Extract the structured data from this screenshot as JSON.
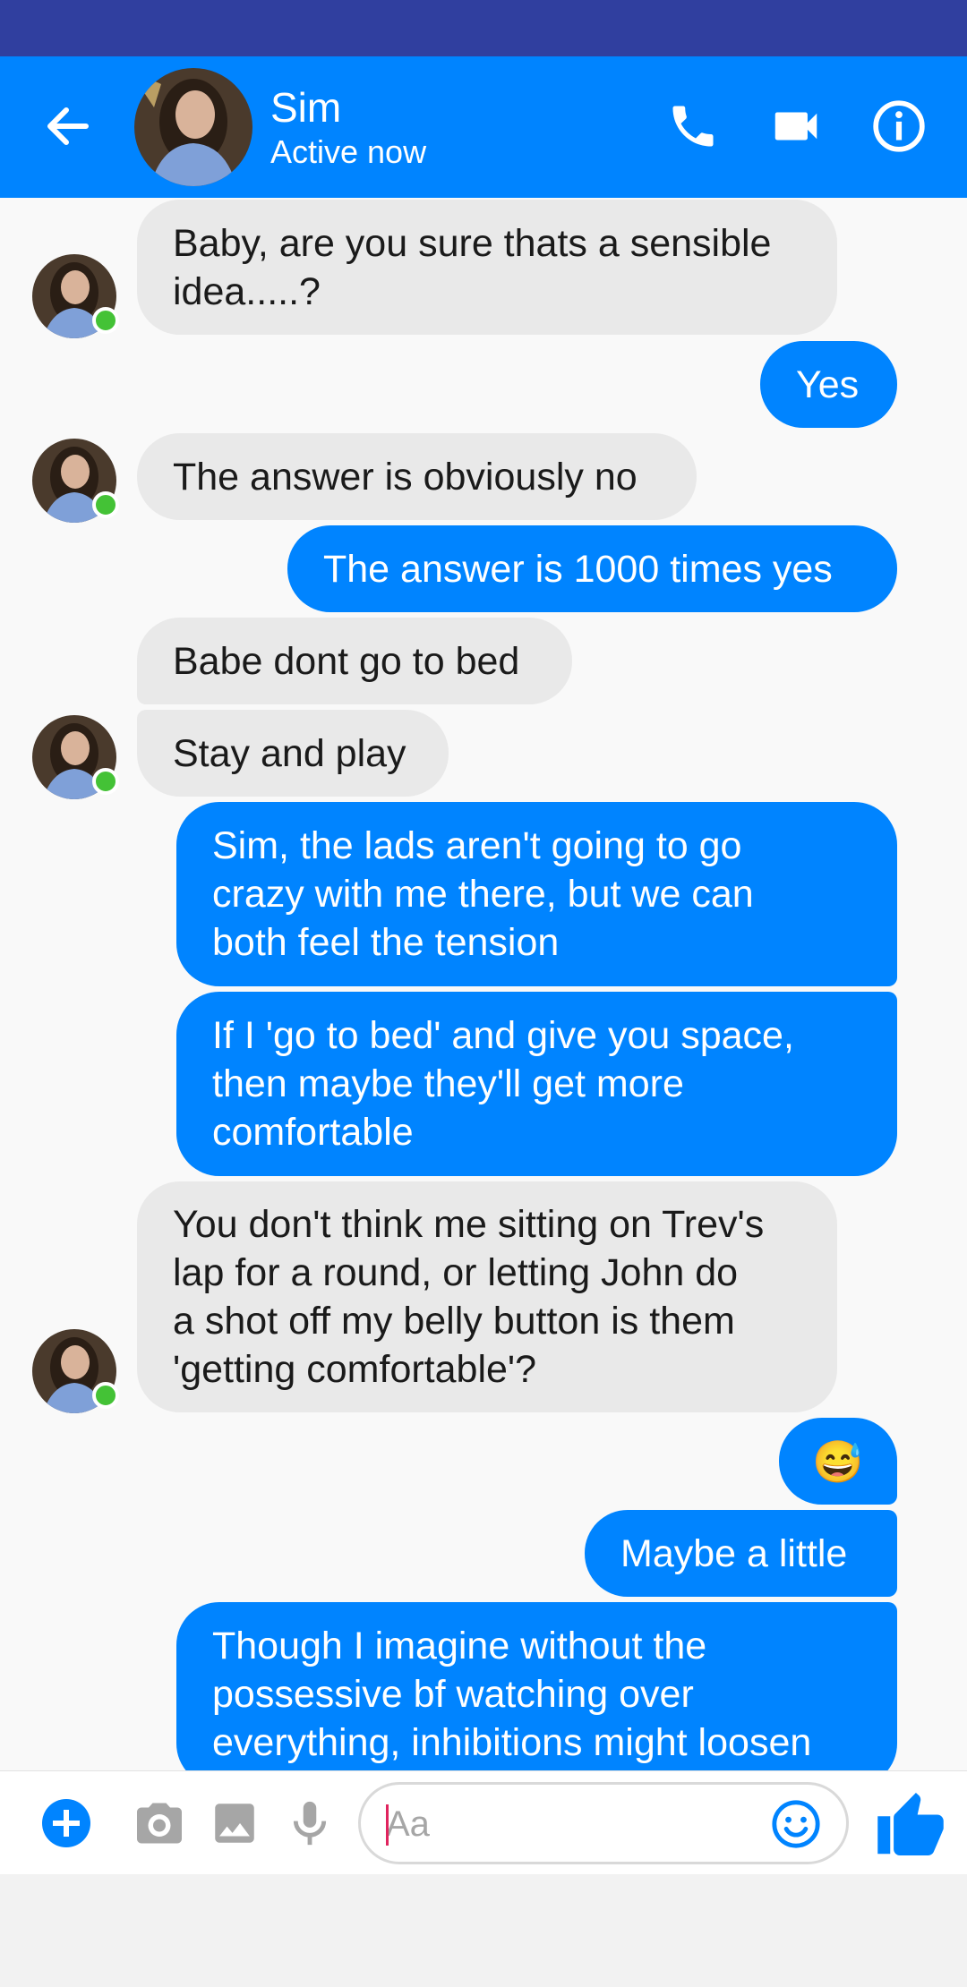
{
  "colors": {
    "status_bar": "#303f9f",
    "header": "#0084ff",
    "outgoing_bubble": "#0084ff",
    "incoming_bubble": "#e9e9e9",
    "online": "#44c236"
  },
  "header": {
    "contact_name": "Sim",
    "contact_status": "Active now",
    "icons": [
      "back-arrow-icon",
      "phone-icon",
      "video-camera-icon",
      "info-icon"
    ]
  },
  "messages": [
    {
      "direction": "in",
      "text": "Baby, are you sure thats a sensible\nidea.....?"
    },
    {
      "direction": "out",
      "text": "Yes"
    },
    {
      "direction": "in",
      "text": "The answer is obviously no"
    },
    {
      "direction": "out",
      "text": "The answer is 1000 times yes"
    },
    {
      "direction": "in",
      "text": "Babe dont go to bed"
    },
    {
      "direction": "in",
      "text": "Stay and play"
    },
    {
      "direction": "out",
      "text": "Sim, the lads aren't going to go\ncrazy with me there, but we can\nboth feel the tension"
    },
    {
      "direction": "out",
      "text": "If I 'go to bed' and give you space,\nthen maybe they'll get more\ncomfortable"
    },
    {
      "direction": "in",
      "text": "You don't think me sitting on Trev's\nlap for a round, or letting John do\na shot off my belly button is them\n'getting comfortable'?"
    },
    {
      "direction": "out",
      "text": "😅"
    },
    {
      "direction": "out",
      "text": "Maybe a little"
    },
    {
      "direction": "out",
      "text": "Though I imagine without the\npossessive bf watching over\neverything, inhibitions might loosen"
    }
  ],
  "composer": {
    "placeholder": "Aa",
    "value": "",
    "icons": [
      "add-icon",
      "camera-icon",
      "image-icon",
      "microphone-icon",
      "emoji-icon",
      "thumbs-up-icon"
    ]
  }
}
